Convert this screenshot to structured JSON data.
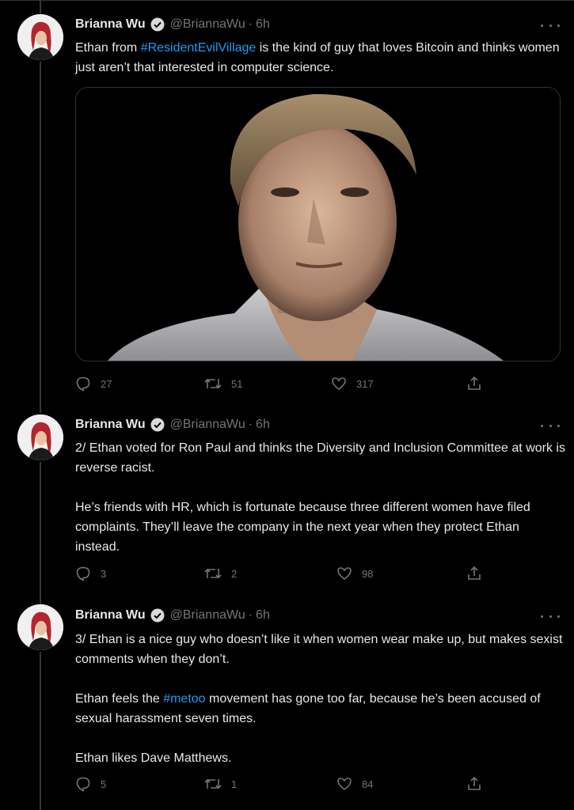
{
  "tweets": [
    {
      "author_name": "Brianna Wu",
      "handle": "@BriannaWu",
      "separator": "·",
      "time": "6h",
      "text_parts": [
        {
          "text": "Ethan from ",
          "tag": false
        },
        {
          "text": "#ResidentEvilVillage",
          "tag": true
        },
        {
          "text": " is the kind of guy that loves Bitcoin and thinks women just aren’t that interested in computer science.",
          "tag": false
        }
      ],
      "has_image": true,
      "replies": "27",
      "retweets": "51",
      "likes": "317"
    },
    {
      "author_name": "Brianna Wu",
      "handle": "@BriannaWu",
      "separator": "·",
      "time": "6h",
      "paragraph_1": "2/ Ethan voted for Ron Paul and thinks the Diversity and Inclusion Committee at work is reverse racist.",
      "paragraph_2": "He’s friends with HR, which is fortunate because three different women have filed complaints. They’ll leave the company in the next year when they protect Ethan instead.",
      "replies": "3",
      "retweets": "2",
      "likes": "98"
    },
    {
      "author_name": "Brianna Wu",
      "handle": "@BriannaWu",
      "separator": "·",
      "time": "6h",
      "paragraph_1": "3/ Ethan is a nice guy who doesn’t like it when women wear make up, but makes sexist comments when they don’t.",
      "paragraph_2_parts": [
        {
          "text": "Ethan feels the ",
          "tag": false
        },
        {
          "text": "#metoo",
          "tag": true
        },
        {
          "text": " movement has gone too far, because he’s been accused of sexual harassment seven times.",
          "tag": false
        }
      ],
      "paragraph_3": "Ethan likes Dave Matthews.",
      "replies": "5",
      "retweets": "1",
      "likes": "84"
    }
  ],
  "icons": {
    "verified": "verified-badge-icon",
    "more": "more-options-icon",
    "reply": "reply-icon",
    "retweet": "retweet-icon",
    "like": "like-icon",
    "share": "share-icon"
  },
  "colors": {
    "background": "#000000",
    "text": "#e7e9ea",
    "secondary": "#71767b",
    "link": "#1d9bf0",
    "verified": "#d9d9d9"
  }
}
